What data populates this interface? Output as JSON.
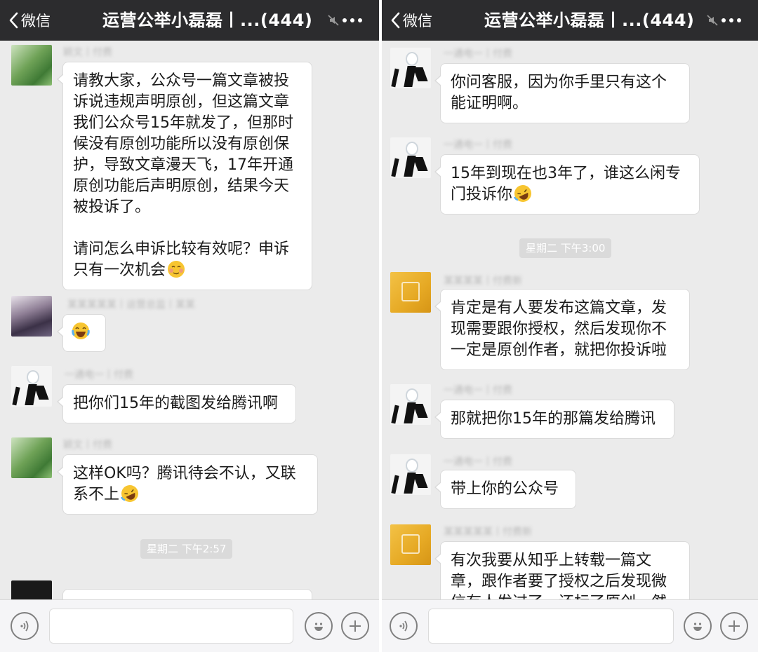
{
  "left": {
    "nav": {
      "back_label": "微信",
      "title": "运营公举小磊磊丨...(444)"
    },
    "messages": [
      {
        "name": "颖文丨付费",
        "text": "请教大家，公众号一篇文章被投诉说违规声明原创，但这篇文章我们公众号15年就发了，但那时候没有原创功能所以没有原创保护，导致文章漫天飞，17年开通原创功能后声明原创，结果今天被投诉了。",
        "text2": "请问怎么申诉比较有效呢？申诉只有一次机会",
        "emoji": "blush-emoji"
      },
      {
        "name": "某某某某某丨运营总监丨某某",
        "emoji": "laughing-tears-emoji"
      },
      {
        "name": "一通电一丨付费",
        "text": "把你们15年的截图发给腾讯啊"
      },
      {
        "name": "颖文丨付费",
        "text": "这样OK吗？腾讯待会不认，又联系不上",
        "emoji": "rolling-laugh-emoji"
      }
    ],
    "timestamp": "星期二 下午2:57"
  },
  "right": {
    "nav": {
      "back_label": "微信",
      "title": "运营公举小磊磊丨...(444)"
    },
    "messages": [
      {
        "name": "一通电一丨付费",
        "text": "你问客服，因为你手里只有这个能证明啊。"
      },
      {
        "name": "一通电一丨付费",
        "text": "15年到现在也3年了，谁这么闲专门投诉你",
        "emoji": "rolling-laugh-emoji"
      },
      {
        "name": "某某某某丨付费新",
        "text": "肯定是有人要发布这篇文章，发现需要跟你授权，然后发现你不一定是原创作者，就把你投诉啦"
      },
      {
        "name": "一通电一丨付费",
        "text": "那就把你15年的那篇发给腾讯"
      },
      {
        "name": "一通电一丨付费",
        "text": "带上你的公众号"
      },
      {
        "name": "某某某某某丨付费新",
        "text": "有次我要从知乎上转载一篇文章，跟作者要了授权之后发现微信有人发过了，还标了原创，然"
      }
    ],
    "timestamp": "星期二 下午3:00"
  },
  "icons": {
    "back": "chevron-left-icon",
    "mute": "mute-icon",
    "more": "more-dots-icon",
    "voice": "voice-icon",
    "emoji": "emoji-icon",
    "plus": "plus-icon"
  },
  "colors": {
    "navbar": "#2c2c2e",
    "chat_bg": "#ebebeb",
    "bubble": "#ffffff",
    "timestamp_bg": "#dadada"
  }
}
